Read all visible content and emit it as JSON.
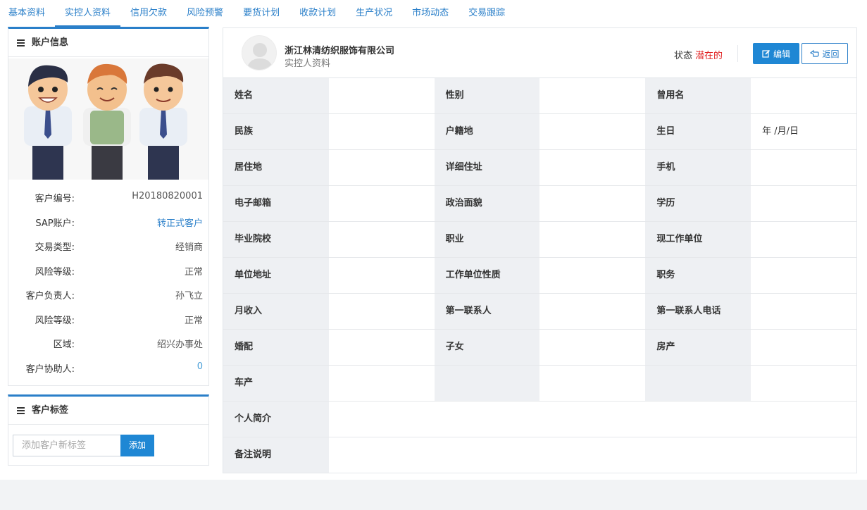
{
  "tabs": [
    "基本资料",
    "实控人资料",
    "信用欠款",
    "风险预警",
    "要货计划",
    "收款计划",
    "生产状况",
    "市场动态",
    "交易跟踪"
  ],
  "active_tab": "实控人资料",
  "account_panel": {
    "title": "账户信息",
    "rows": [
      {
        "label": "客户编号:",
        "value": "H20180820001"
      },
      {
        "label": "SAP账户:",
        "value": "转正式客户"
      },
      {
        "label": "交易类型:",
        "value": "经销商"
      },
      {
        "label": "风险等级:",
        "value": "正常"
      },
      {
        "label": "客户负责人:",
        "value": "孙飞立"
      },
      {
        "label": "风险等级:",
        "value": "正常"
      },
      {
        "label": "区域:",
        "value": "绍兴办事处"
      },
      {
        "label": "客户协助人:",
        "value": "0"
      }
    ]
  },
  "tags_panel": {
    "title": "客户标签",
    "input_placeholder": "添加客户新标签",
    "add_label": "添加"
  },
  "header": {
    "company": "浙江林清纺织服饰有限公司",
    "subtitle": "实控人资料",
    "status_label": "状态",
    "status_value": "潜在的",
    "edit_label": "编辑",
    "back_label": "返回"
  },
  "fields": [
    [
      {
        "k": "姓名",
        "v": ""
      },
      {
        "k": "性别",
        "v": ""
      },
      {
        "k": "曾用名",
        "v": ""
      }
    ],
    [
      {
        "k": "民族",
        "v": ""
      },
      {
        "k": "户籍地",
        "v": ""
      },
      {
        "k": "生日",
        "v": "年 /月/日"
      }
    ],
    [
      {
        "k": "居住地",
        "v": ""
      },
      {
        "k": "详细住址",
        "v": ""
      },
      {
        "k": "手机",
        "v": ""
      }
    ],
    [
      {
        "k": "电子邮箱",
        "v": ""
      },
      {
        "k": "政治面貌",
        "v": ""
      },
      {
        "k": "学历",
        "v": ""
      }
    ],
    [
      {
        "k": "毕业院校",
        "v": ""
      },
      {
        "k": "职业",
        "v": ""
      },
      {
        "k": "现工作单位",
        "v": ""
      }
    ],
    [
      {
        "k": "单位地址",
        "v": ""
      },
      {
        "k": "工作单位性质",
        "v": ""
      },
      {
        "k": "职务",
        "v": ""
      }
    ],
    [
      {
        "k": "月收入",
        "v": ""
      },
      {
        "k": "第一联系人",
        "v": ""
      },
      {
        "k": "第一联系人电话",
        "v": ""
      }
    ],
    [
      {
        "k": "婚配",
        "v": ""
      },
      {
        "k": "子女",
        "v": ""
      },
      {
        "k": "房产",
        "v": ""
      }
    ],
    [
      {
        "k": "车产",
        "v": ""
      },
      {
        "k": "",
        "v": ""
      },
      {
        "k": "",
        "v": ""
      }
    ]
  ],
  "wide_fields": [
    {
      "k": "个人简介",
      "v": ""
    },
    {
      "k": "备注说明",
      "v": ""
    }
  ]
}
